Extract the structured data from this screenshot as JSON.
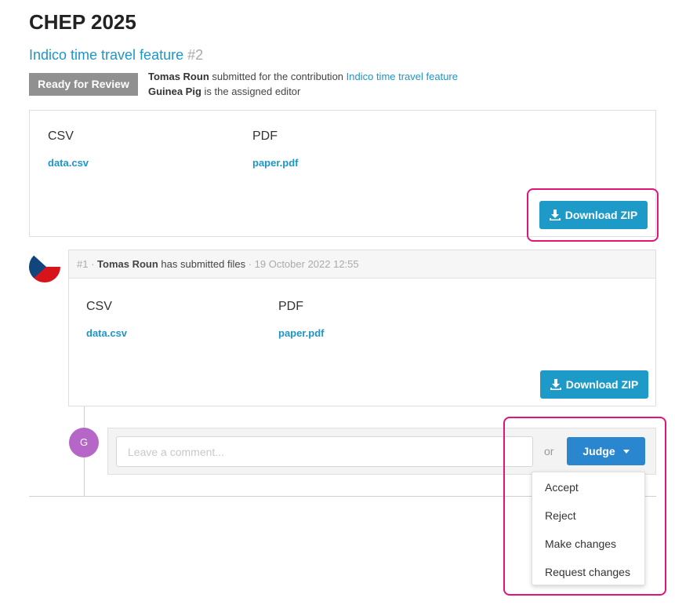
{
  "event": {
    "title": "CHEP 2025"
  },
  "contribution": {
    "title": "Indico time travel feature",
    "number": "#2"
  },
  "status": {
    "badge": "Ready for Review"
  },
  "meta": {
    "submitter": "Tomas Roun",
    "submitted_text": " submitted for the contribution ",
    "contribution_link": "Indico time travel feature",
    "editor": "Guinea Pig",
    "editor_text": " is the assigned editor"
  },
  "files": [
    {
      "type": "CSV",
      "name": "data.csv"
    },
    {
      "type": "PDF",
      "name": "paper.pdf"
    }
  ],
  "download_label": "Download ZIP",
  "timeline": {
    "number": "#1",
    "author": "Tomas Roun",
    "action": " has submitted files ",
    "date": "19 October 2022 12:55",
    "files": [
      {
        "type": "CSV",
        "name": "data.csv"
      },
      {
        "type": "PDF",
        "name": "paper.pdf"
      }
    ]
  },
  "comment": {
    "avatar_initial": "G",
    "placeholder": "Leave a comment...",
    "or_label": "or",
    "judge_label": "Judge"
  },
  "judge_menu": [
    "Accept",
    "Reject",
    "Make changes",
    "Request changes"
  ],
  "colors": {
    "link": "#1e95c9",
    "button": "#1e9ac8",
    "judge": "#2a86cf",
    "highlight": "#e0157a",
    "avatar": "#b566c6"
  }
}
